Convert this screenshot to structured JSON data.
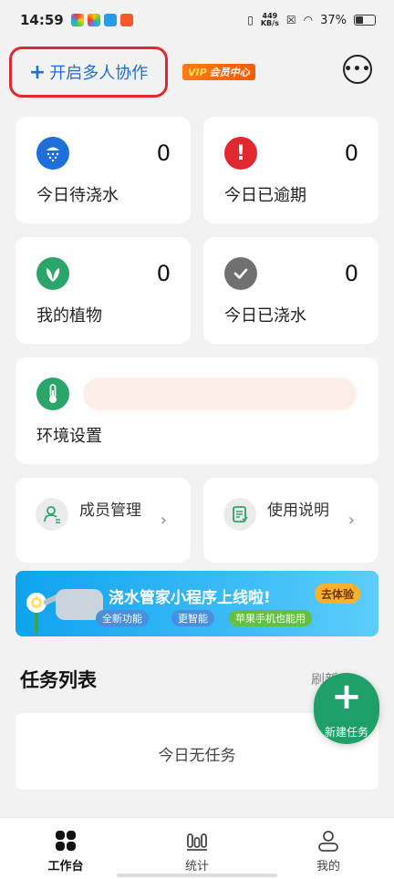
{
  "status_bar": {
    "time": "14:59",
    "net_speed_value": "449",
    "net_speed_unit": "KB/s",
    "battery": "37%"
  },
  "header": {
    "collab_label": "开启多人协作",
    "vip_prefix": "VIP",
    "vip_label": "会员中心"
  },
  "stats": [
    {
      "label": "今日待浇水",
      "count": "0",
      "icon": "watering-icon",
      "color": "#1e6fd9"
    },
    {
      "label": "今日已逾期",
      "count": "0",
      "icon": "alert-icon",
      "color": "#e0282e"
    },
    {
      "label": "我的植物",
      "count": "0",
      "icon": "leaf-icon",
      "color": "#2ca56a"
    },
    {
      "label": "今日已浇水",
      "count": "0",
      "icon": "check-icon",
      "color": "#707070"
    }
  ],
  "env": {
    "label": "环境设置",
    "icon": "thermometer-icon"
  },
  "shortcuts": [
    {
      "label": "成员管理",
      "icon": "member-icon"
    },
    {
      "label": "使用说明",
      "icon": "manual-icon"
    }
  ],
  "banner": {
    "title": "浇水管家小程序上线啦!",
    "cta": "去体验",
    "tags": [
      "全新功能",
      "更智能",
      "苹果手机也能用"
    ]
  },
  "tasks": {
    "title": "任务列表",
    "refresh": "刷新",
    "empty": "今日无任务",
    "fab_label": "新建任务"
  },
  "tabbar": [
    {
      "label": "工作台",
      "icon": "workbench-icon",
      "active": true
    },
    {
      "label": "统计",
      "icon": "stats-icon",
      "active": false
    },
    {
      "label": "我的",
      "icon": "profile-icon",
      "active": false
    }
  ],
  "colors": {
    "accent": "#1fa068",
    "link": "#1e6fd9",
    "highlight": "#e0282e"
  }
}
